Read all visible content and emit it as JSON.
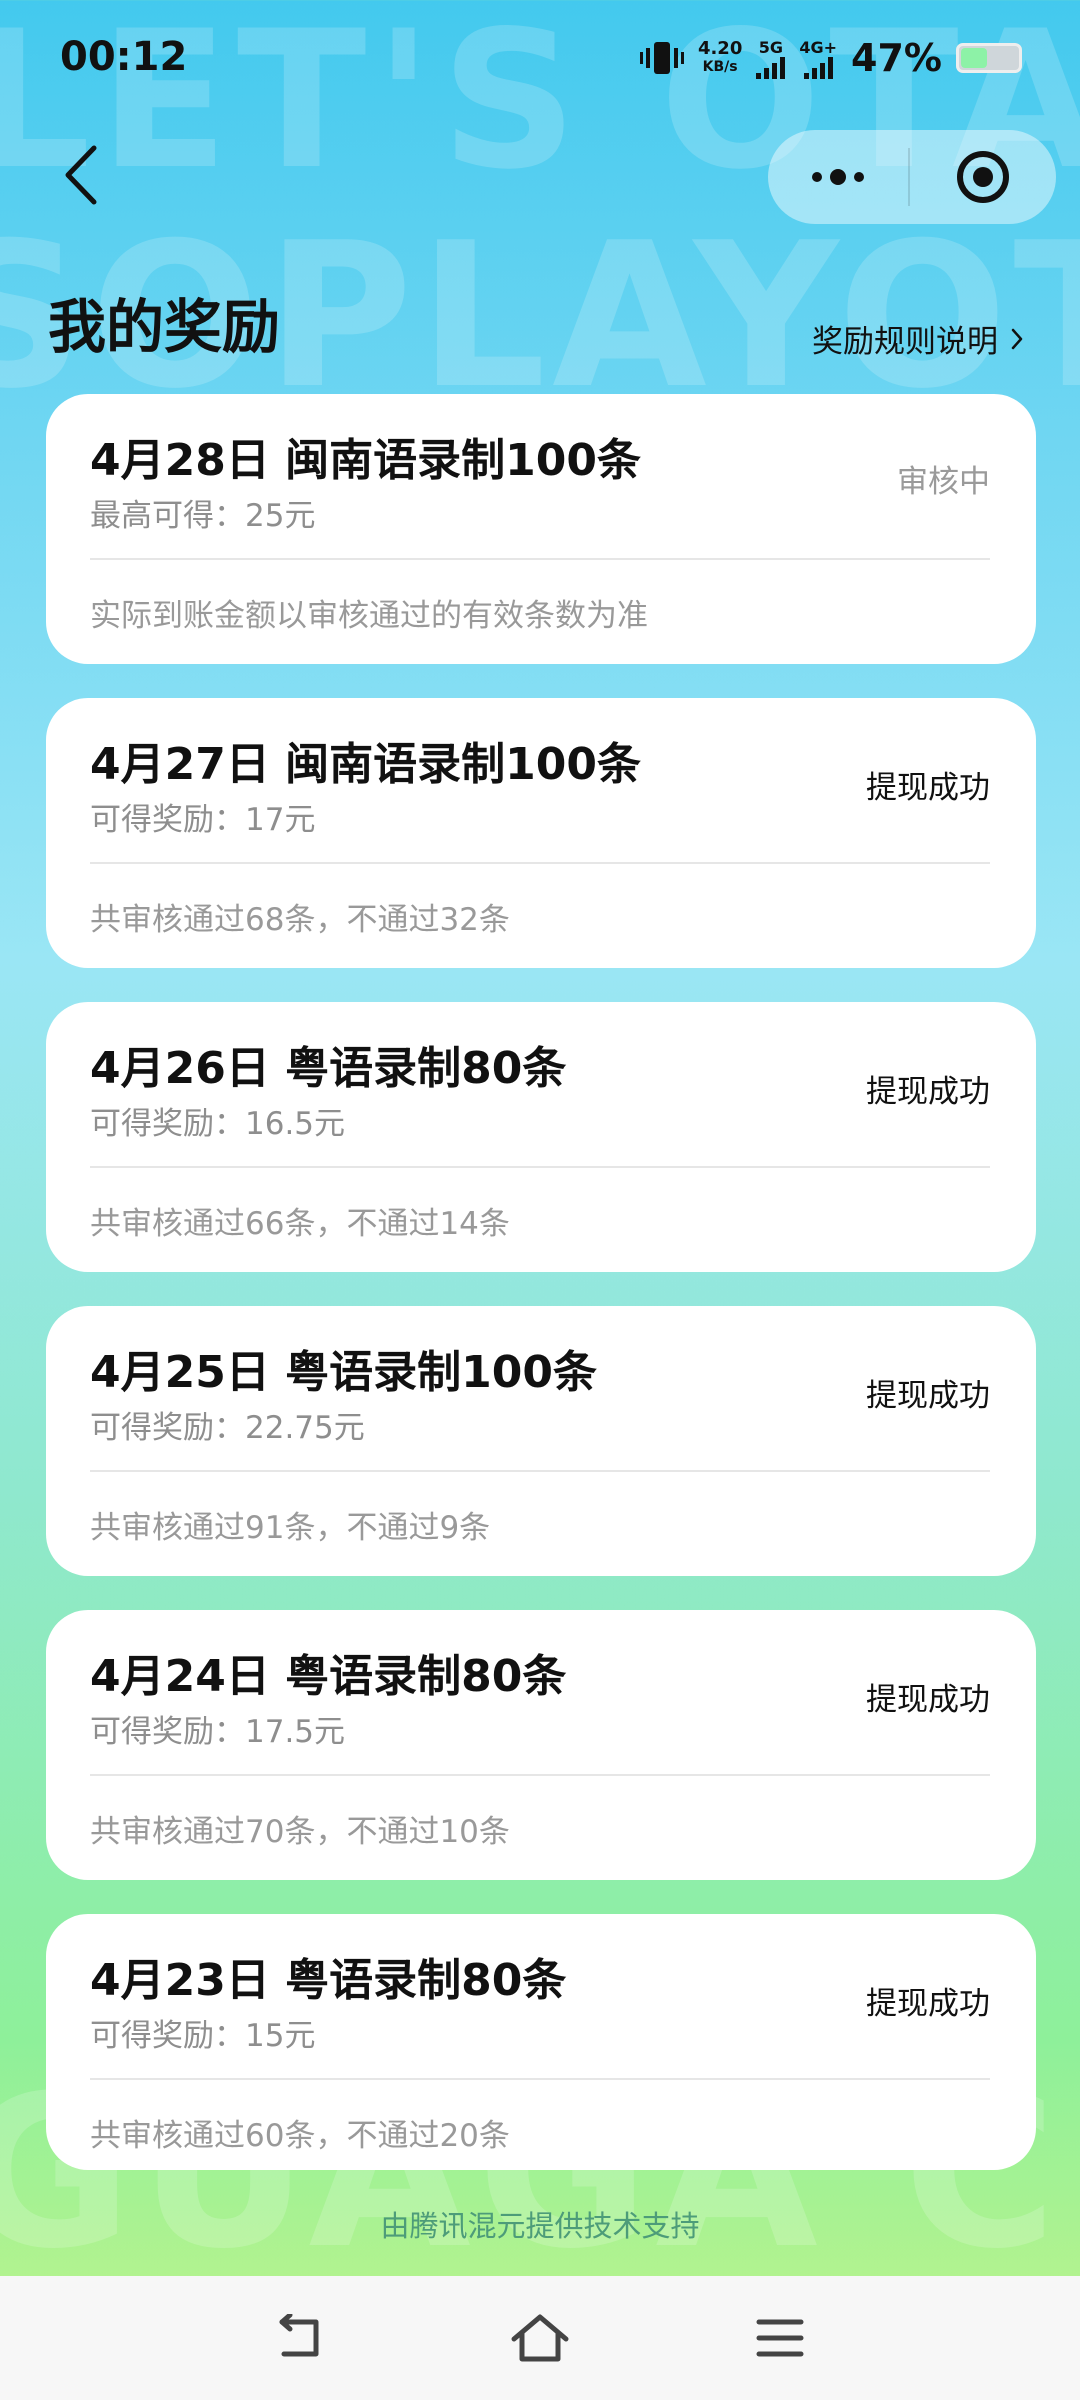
{
  "status_bar": {
    "time": "00:12",
    "speed_value": "4.20",
    "speed_unit": "KB/s",
    "net1": "5G",
    "net2": "4G+",
    "battery": "47%",
    "battery_level": 0.47,
    "battery_color": "#8df2a7"
  },
  "nav": {
    "back_icon": "chevron-left-icon",
    "more_icon": "more-dots-icon",
    "close_icon": "target-close-icon"
  },
  "page": {
    "title": "我的奖励",
    "rules_link": "奖励规则说明"
  },
  "rewards": [
    {
      "title": "4月28日 闽南语录制100条",
      "amount": "最高可得：25元",
      "status": "审核中",
      "note": "实际到账金额以审核通过的有效条数为准"
    },
    {
      "title": "4月27日 闽南语录制100条",
      "amount": "可得奖励：17元",
      "status": "提现成功",
      "note": "共审核通过68条，不通过32条"
    },
    {
      "title": "4月26日 粤语录制80条",
      "amount": "可得奖励：16.5元",
      "status": "提现成功",
      "note": "共审核通过66条，不通过14条"
    },
    {
      "title": "4月25日 粤语录制100条",
      "amount": "可得奖励：22.75元",
      "status": "提现成功",
      "note": "共审核通过91条，不通过9条"
    },
    {
      "title": "4月24日 粤语录制80条",
      "amount": "可得奖励：17.5元",
      "status": "提现成功",
      "note": "共审核通过70条，不通过10条"
    },
    {
      "title": "4月23日 粤语录制80条",
      "amount": "可得奖励：15元",
      "status": "提现成功",
      "note": "共审核通过60条，不通过20条"
    }
  ],
  "footer": {
    "powered_by": "由腾讯混元提供技术支持"
  },
  "system_nav": {
    "back_icon": "return-icon",
    "home_icon": "home-icon",
    "menu_icon": "menu-icon"
  },
  "watermark_text": [
    "LET'S OTAI",
    "SOPLAYOT",
    "GUAGA CHI"
  ]
}
